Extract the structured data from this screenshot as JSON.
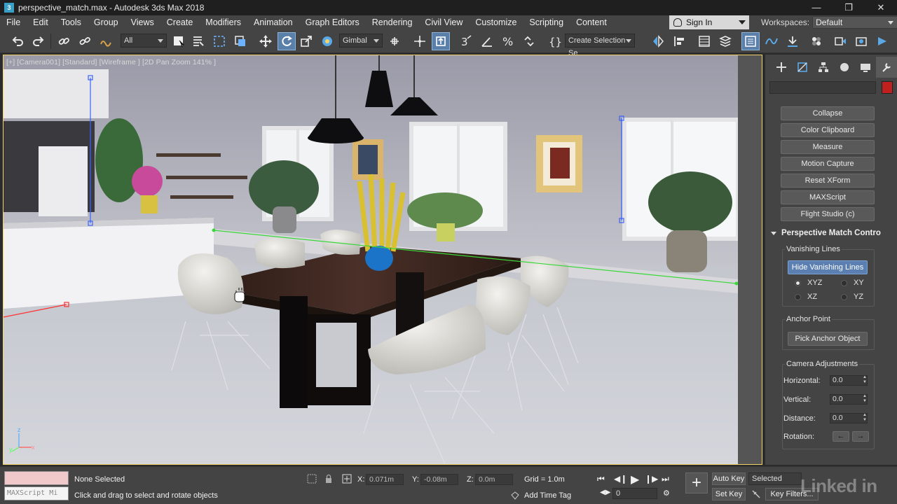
{
  "window": {
    "title": "perspective_match.max - Autodesk 3ds Max 2018",
    "app_icon": "3"
  },
  "menu": {
    "items": [
      "File",
      "Edit",
      "Tools",
      "Group",
      "Views",
      "Create",
      "Modifiers",
      "Animation",
      "Graph Editors",
      "Rendering",
      "Civil View",
      "Customize",
      "Scripting",
      "Content"
    ],
    "signin_label": "Sign In",
    "workspaces_label": "Workspaces:",
    "workspaces_value": "Default"
  },
  "toolbar": {
    "selection_filter": "All",
    "ref_coord": "Gimbal",
    "named_selection_placeholder": "Create Selection Se"
  },
  "viewport": {
    "label": "[+] [Camera001] [Standard] [Wireframe ] [2D Pan Zoom 141% ]",
    "axis_labels": {
      "z": "z",
      "y": "y",
      "x": "x"
    }
  },
  "command_panel": {
    "utility_buttons": [
      "Collapse",
      "Color Clipboard",
      "Measure",
      "Motion Capture",
      "Reset XForm",
      "MAXScript",
      "Flight Studio (c)"
    ],
    "rollout_title": "Perspective Match Contro",
    "vanishing_lines": {
      "title": "Vanishing Lines",
      "button": "Hide Vanishing Lines",
      "options": [
        {
          "label": "XYZ",
          "selected": true
        },
        {
          "label": "XY",
          "selected": false
        },
        {
          "label": "XZ",
          "selected": false
        },
        {
          "label": "YZ",
          "selected": false
        }
      ]
    },
    "anchor_point": {
      "title": "Anchor Point",
      "button": "Pick Anchor Object"
    },
    "camera_adjustments": {
      "title": "Camera Adjustments",
      "fields": [
        {
          "label": "Horizontal:",
          "value": "0.0"
        },
        {
          "label": "Vertical:",
          "value": "0.0"
        },
        {
          "label": "Distance:",
          "value": "0.0"
        }
      ],
      "rotation_label": "Rotation:",
      "rotation_left": "←",
      "rotation_right": "→"
    }
  },
  "status": {
    "maxscript_label": "MAXScript Mi",
    "selection": "None Selected",
    "prompt": "Click and drag to select and rotate objects",
    "x_label": "X:",
    "x_value": "0.071m",
    "y_label": "Y:",
    "y_value": "-0.08m",
    "z_label": "Z:",
    "z_value": "0.0m",
    "grid": "Grid = 1.0m",
    "add_time_tag": "Add Time Tag",
    "frame": "0",
    "auto_key": "Auto Key",
    "set_key": "Set Key",
    "key_mode": "Selected",
    "key_filters": "Key Filters...",
    "watermark": "Linked in"
  },
  "colors": {
    "accent": "#5a7fa8",
    "viewport_border": "#f3d36b",
    "vanishing_line": "#39d739",
    "swatch": "#c0211f"
  }
}
